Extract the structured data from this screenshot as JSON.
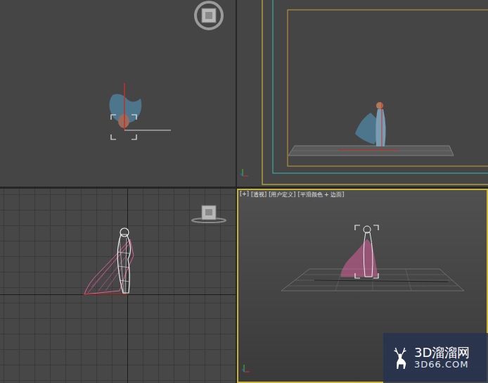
{
  "viewports": [
    {
      "kind": "top",
      "active": false,
      "label": []
    },
    {
      "kind": "camera",
      "active": false,
      "label": []
    },
    {
      "kind": "left",
      "active": false,
      "label": []
    },
    {
      "kind": "perspective",
      "active": true,
      "label": [
        "[+]",
        "[透视]",
        "[用户定义]",
        "[平滑颜色 + 边面]"
      ]
    }
  ],
  "watermark": {
    "logo": "3D溜溜网",
    "url": "3D66.COM"
  }
}
